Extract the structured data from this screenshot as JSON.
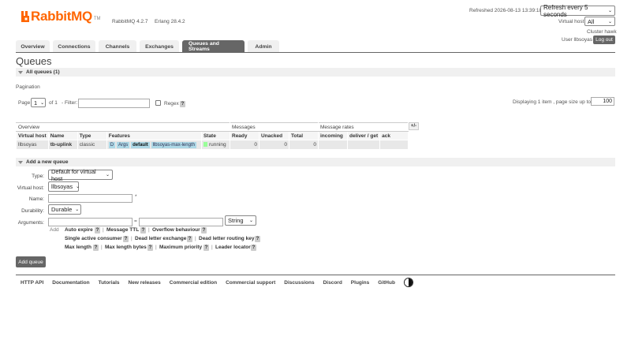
{
  "brand": {
    "name": "RabbitMQ",
    "tm": "TM",
    "version": "RabbitMQ 4.2.7",
    "erlang": "Erlang 28.4.2",
    "color": "#ff6600"
  },
  "header": {
    "refreshed": "Refreshed 2026-08-13 13:39:18",
    "refresh_select": "Refresh every 5 seconds",
    "vhost_label": "Virtual host",
    "vhost_select": "All",
    "cluster": "Cluster hawk",
    "user": "User llbsoyas",
    "logout": "Log out"
  },
  "tabs": [
    "Overview",
    "Connections",
    "Channels",
    "Exchanges",
    "Queues and Streams",
    "Admin"
  ],
  "active_tab": "Queues and Streams",
  "page_title": "Queues",
  "all_queues": "All queues (1)",
  "pagination": {
    "label": "Pagination",
    "page_label": "Page",
    "page_value": "1",
    "of_label": "of 1",
    "filter_label": "- Filter:",
    "regex_label": "Regex",
    "help": "?",
    "displaying": "Displaying 1 item , page size up to:",
    "page_size": "100"
  },
  "table": {
    "groups": {
      "overview": "Overview",
      "messages": "Messages",
      "rates": "Message rates",
      "toggle": "+/-"
    },
    "headers": [
      "Virtual host",
      "Name",
      "Type",
      "Features",
      "State",
      "Ready",
      "Unacked",
      "Total",
      "incoming",
      "deliver / get",
      "ack"
    ],
    "row": {
      "vhost": "llbsoyas",
      "name": "tb-uplink",
      "type": "classic",
      "features": [
        "D",
        "Args",
        "default",
        "llbsoyas-max-length"
      ],
      "state": "running",
      "ready": "0",
      "unacked": "0",
      "total": "0"
    }
  },
  "add_queue": {
    "section": "Add a new queue",
    "type_label": "Type:",
    "type_value": "Default for virtual host",
    "vhost_label": "Virtual host:",
    "vhost_value": "llbsoyas",
    "name_label": "Name:",
    "name_required": "*",
    "durability_label": "Durability:",
    "durability_value": "Durable",
    "arguments_label": "Arguments:",
    "equals": "=",
    "arg_type": "String",
    "add_label": "Add",
    "args_row1": [
      "Auto expire",
      "Message TTL",
      "Overflow behaviour"
    ],
    "args_row2": [
      "Single active consumer",
      "Dead letter exchange",
      "Dead letter routing key"
    ],
    "args_row3": [
      "Max length",
      "Max length bytes",
      "Maximum priority",
      "Leader locator"
    ],
    "button": "Add queue"
  },
  "footer": [
    "HTTP API",
    "Documentation",
    "Tutorials",
    "New releases",
    "Commercial edition",
    "Commercial support",
    "Discussions",
    "Discord",
    "Plugins",
    "GitHub"
  ]
}
